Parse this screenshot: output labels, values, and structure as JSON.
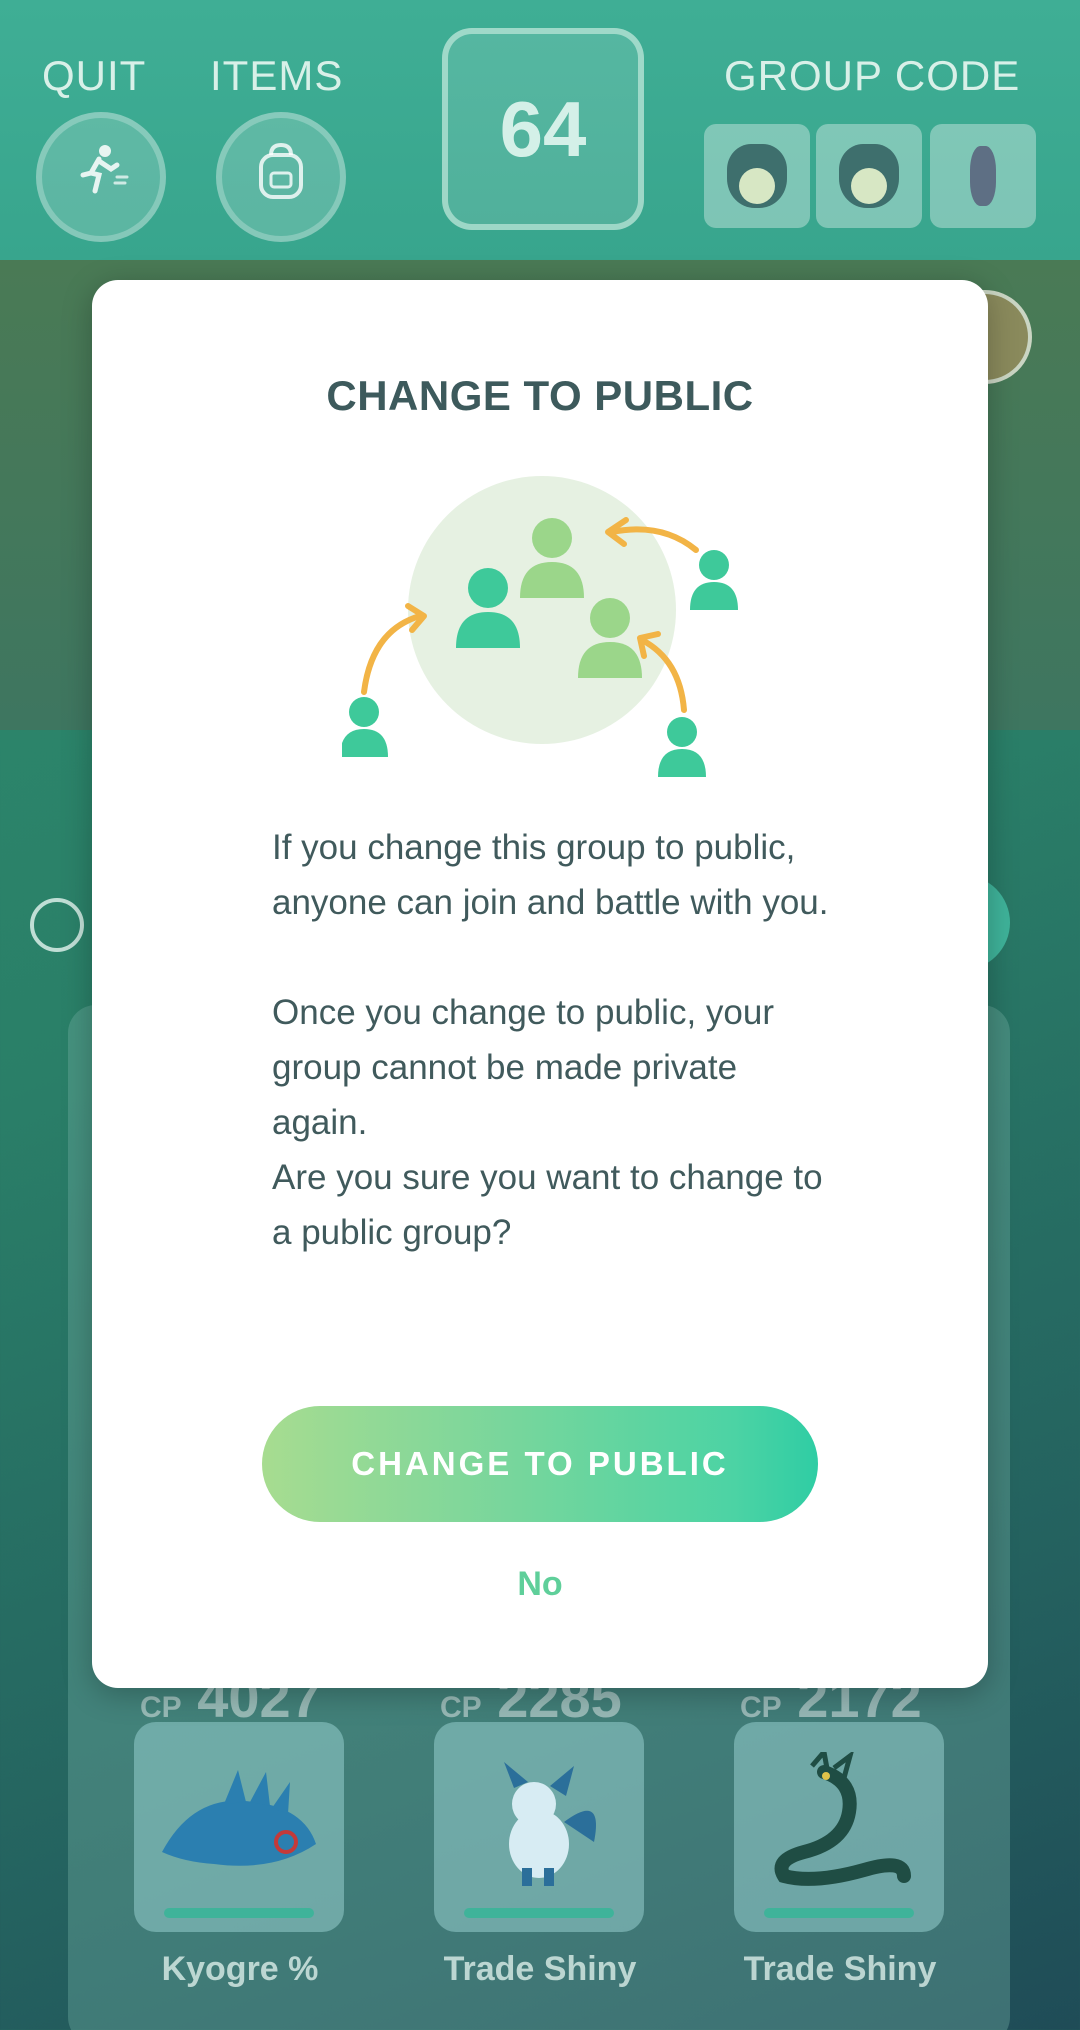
{
  "header": {
    "quit_label": "QUIT",
    "items_label": "ITEMS",
    "count": "64",
    "group_code_label": "GROUP CODE"
  },
  "roster": [
    {
      "cp_prefix": "CP",
      "cp": "4027",
      "label": "Kyogre %"
    },
    {
      "cp_prefix": "CP",
      "cp": "2285",
      "label": "Trade Shiny"
    },
    {
      "cp_prefix": "CP",
      "cp": "2172",
      "label": "Trade Shiny"
    }
  ],
  "dialog": {
    "title": "CHANGE TO PUBLIC",
    "body_1": "If you change this group to public, anyone can join and battle with you.",
    "body_2": "Once you change to public, your group cannot be made private again.",
    "body_3": "Are you sure you want to change to a public group?",
    "confirm_label": "CHANGE TO PUBLIC",
    "cancel_label": "No"
  },
  "icons": {
    "quit": "running-person-icon",
    "items": "backpack-icon",
    "illustration": "people-joining-group-icon"
  },
  "colors": {
    "accent": "#4cd3a4",
    "title_text": "#3d5a5c",
    "arrow": "#f2b446",
    "person": "#3ec99a"
  }
}
